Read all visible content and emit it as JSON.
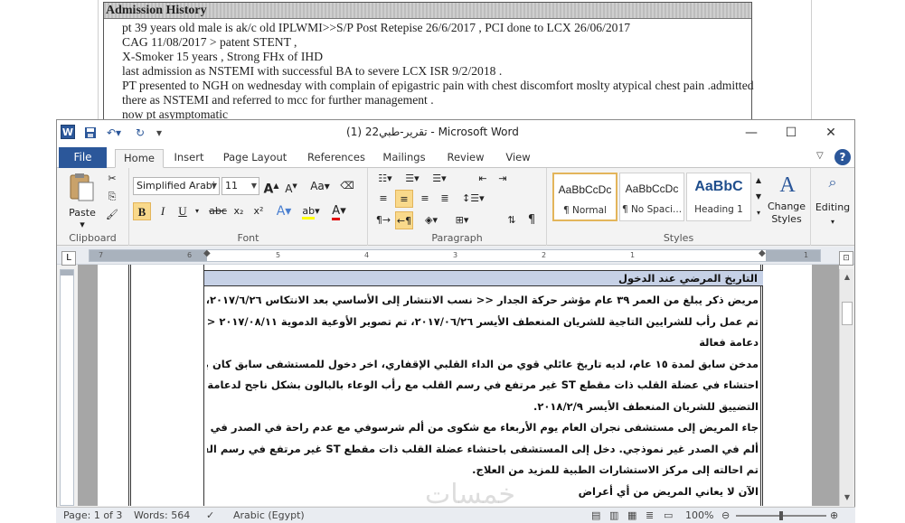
{
  "scanned_doc": {
    "header": "Admission History",
    "lines": [
      "pt 39 years old male is ak/c old IPLWMI>>S/P Post Retepise 26/6/2017 , PCI done to LCX 26/06/2017",
      "CAG 11/08/2017 > patent  STENT ,",
      "X-Smoker 15 years , Strong FHx of IHD",
      "last admission as NSTEMI  with successful BA to severe LCX ISR 9/2/2018 .",
      "PT presented to NGH on wednesday with complain of epigastric pain with chest discomfort moslty atypical chest pain .admitted",
      "there as NSTEMI  and referred to mcc for further management .",
      "now pt asymptomatic"
    ]
  },
  "window": {
    "title": "تقرير-طبي22 (1)  -  Microsoft Word",
    "app_icon_letter": "W"
  },
  "tabs": {
    "file": "File",
    "items": [
      "Home",
      "Insert",
      "Page Layout",
      "References",
      "Mailings",
      "Review",
      "View"
    ]
  },
  "ribbon": {
    "clipboard": {
      "label": "Clipboard",
      "paste": "Paste"
    },
    "font": {
      "label": "Font",
      "font_name": "Simplified Arabi",
      "font_size": "11",
      "bold": "B",
      "italic": "I",
      "underline": "U",
      "strike": "abc",
      "subscript": "x₂",
      "superscript": "x²",
      "change_case": "Aa"
    },
    "paragraph": {
      "label": "Paragraph"
    },
    "styles": {
      "label": "Styles",
      "items": [
        {
          "sample": "AaBbCcDc",
          "name": "¶ Normal"
        },
        {
          "sample": "AaBbCcDc",
          "name": "¶ No Spaci..."
        },
        {
          "sample": "AaBbC",
          "name": "Heading 1"
        }
      ],
      "change_styles": "Change Styles"
    },
    "editing": {
      "label": "Editing"
    }
  },
  "ruler": {
    "ticks": [
      "7",
      "6",
      "5",
      "4",
      "3",
      "2",
      "1",
      "1"
    ]
  },
  "document": {
    "table_header": "التاريخ المرضي عند الدخول",
    "lines": [
      "مريض ذكر يبلغ من العمر ٣٩ عام مؤشر حركة الجدار << نسب الانتشار إلى الأساسي  بعد الانتكاس ٢٠١٧/٦/٢٦،",
      "تم عمل رأب للشرايين التاجية للشريان المنعطف الأيسر  ٢٠١٧/٠٦/٢٦، تم تصوير الأوعية الدموية ٢٠١٧/٠٨/١١ <",
      "دعامة فعالة",
      "مدخن سابق لمدة ١٥ عام، لديه تاريخ عائلي قوي من الداء القلبي الإقفاري، اخر دخول للمستشفى سابق كان بسبب",
      "احتشاء في عضلة القلب ذات مقطع ST غير مرتفع في رسم القلب مع رأب الوعاء بالبالون بشكل ناجح لدعامة عودة",
      "التضييق للشريان المنعطف الأيسر ٢٠١٨/٢/٩.",
      "جاء المريض إلى مستشفى نجران العام يوم الأربعاء مع شكوى من ألم شرسوفي مع عدم راحة في الصدر في الغالب",
      "ألم في الصدر غير نموذجي. دخل إلى المستشفى باحتشاء عضلة القلب ذات مقطع ST غير مرتفع في رسم القلب وقد",
      "تم احالته إلى مركز الاستشارات الطبية للمزيد من العلاج.",
      "الآن لا يعاني المريض من أي أعراض"
    ]
  },
  "status": {
    "page": "Page: 1 of 3",
    "words": "Words: 564",
    "language": "Arabic (Egypt)",
    "zoom": "100%"
  },
  "watermark": "خمسات"
}
